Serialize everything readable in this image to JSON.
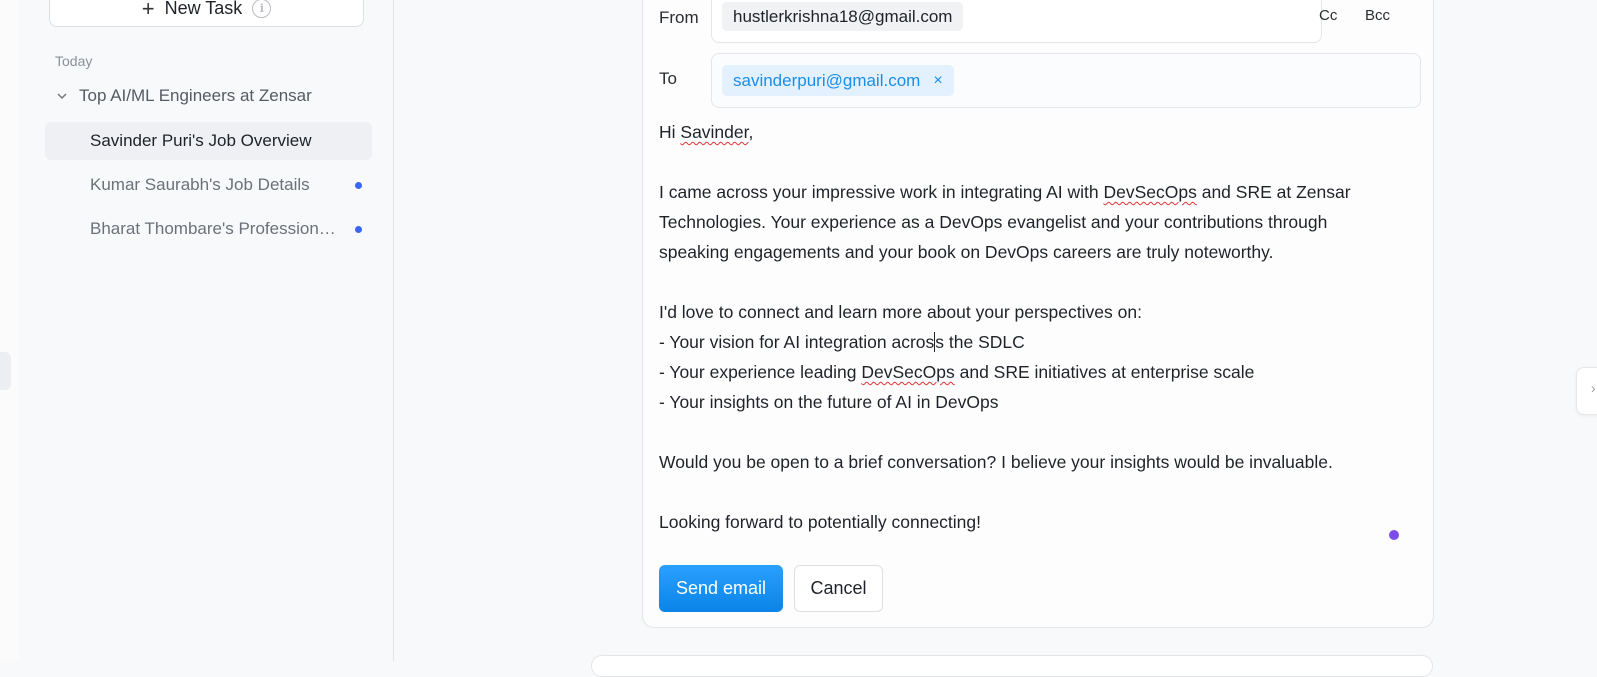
{
  "sidebar": {
    "new_task_label": "New Task",
    "section_label": "Today",
    "group_title": "Top AI/ML Engineers at Zensar",
    "tasks": [
      {
        "label": "Savinder Puri's Job Overview",
        "active": true,
        "unread": false
      },
      {
        "label": "Kumar Saurabh's Job Details",
        "active": false,
        "unread": true
      },
      {
        "label": "Bharat Thombare's Professional Profile",
        "active": false,
        "unread": true
      }
    ]
  },
  "email": {
    "from_label": "From",
    "from_value": "hustlerkrishna18@gmail.com",
    "cc_label": "Cc",
    "bcc_label": "Bcc",
    "to_label": "To",
    "to_value": "savinderpuri@gmail.com",
    "remove_symbol": "×",
    "greeting_pre": "Hi ",
    "greeting_name": "Savinder",
    "greeting_post": ",",
    "p1_a": "I came across your impressive work in integrating AI with ",
    "p1_term": "DevSecOps",
    "p1_b": " and SRE at Zensar",
    "p1_line2": "Technologies. Your experience as a DevOps evangelist and your contributions through",
    "p1_line3": "speaking engagements and your book on DevOps careers are truly noteworthy.",
    "p2_intro": "I'd love to connect and learn more about your perspectives on:",
    "bullet1_a": "- Your vision for AI integration acros",
    "bullet1_b": "s the SDLC",
    "bullet2_a": "- Your experience leading ",
    "bullet2_term": "DevSecOps",
    "bullet2_b": " and SRE initiatives at enterprise scale",
    "bullet3": "- Your insights on the future of AI in DevOps",
    "p3": "Would you be open to a brief conversation? I believe your insights would be invaluable.",
    "p4": "Looking forward to potentially connecting!",
    "send_label": "Send email",
    "cancel_label": "Cancel"
  },
  "colors": {
    "accent": "#0a84e8",
    "unread_dot": "#3a66f5",
    "chip_bg": "#e3f0fd",
    "spell_underline": "#e03131"
  }
}
